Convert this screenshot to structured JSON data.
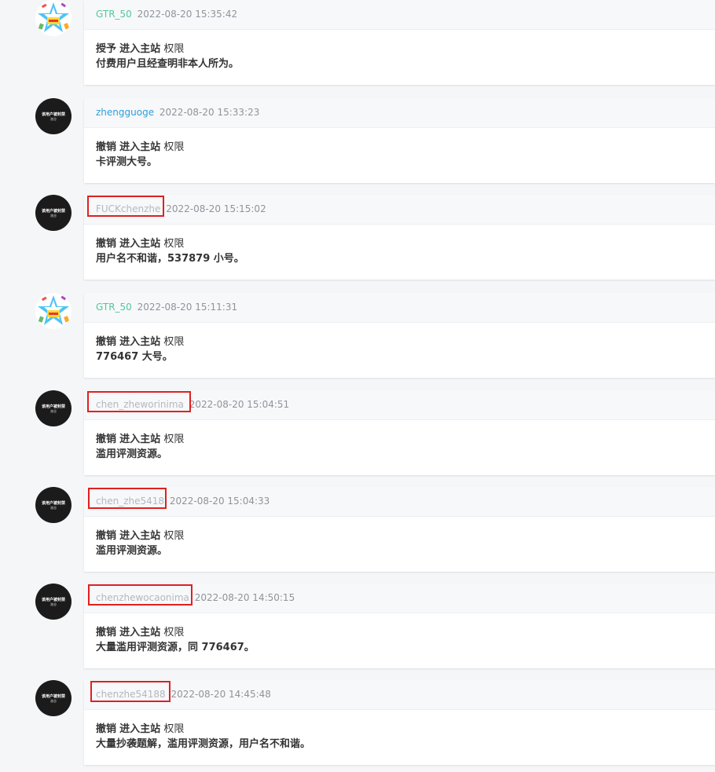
{
  "entries": [
    {
      "avatar": "star-badge",
      "username": "GTR_50",
      "user_color": "green",
      "timestamp": "2022-08-20 15:35:42",
      "action": "授予",
      "target": "进入主站",
      "suffix": "权限",
      "reason": "付费用户且经查明非本人所为。",
      "highlighted": false
    },
    {
      "avatar": "banned",
      "username": "zhengguoge",
      "user_color": "blue",
      "timestamp": "2022-08-20 15:33:23",
      "action": "撤销",
      "target": "进入主站",
      "suffix": "权限",
      "reason": "卡评测大号。",
      "highlighted": false
    },
    {
      "avatar": "banned",
      "username": "FUCKchenzhe",
      "user_color": "grey",
      "timestamp": "2022-08-20 15:15:02",
      "action": "撤销",
      "target": "进入主站",
      "suffix": "权限",
      "reason": "用户名不和谐，537879 小号。",
      "highlighted": true
    },
    {
      "avatar": "star-badge",
      "username": "GTR_50",
      "user_color": "green",
      "timestamp": "2022-08-20 15:11:31",
      "action": "撤销",
      "target": "进入主站",
      "suffix": "权限",
      "reason": "776467 大号。",
      "highlighted": false
    },
    {
      "avatar": "banned",
      "username": "chen_zheworinima",
      "user_color": "grey",
      "timestamp": "2022-08-20 15:04:51",
      "action": "撤销",
      "target": "进入主站",
      "suffix": "权限",
      "reason": "滥用评测资源。",
      "highlighted": true
    },
    {
      "avatar": "banned",
      "username": "chen_zhe5418",
      "user_color": "grey",
      "timestamp": "2022-08-20 15:04:33",
      "action": "撤销",
      "target": "进入主站",
      "suffix": "权限",
      "reason": "滥用评测资源。",
      "highlighted": true
    },
    {
      "avatar": "banned",
      "username": "chenzhewocaonima",
      "user_color": "grey",
      "timestamp": "2022-08-20 14:50:15",
      "action": "撤销",
      "target": "进入主站",
      "suffix": "权限",
      "reason": "大量滥用评测资源，同 776467。",
      "highlighted": true
    },
    {
      "avatar": "banned",
      "username": "chenzhe54188",
      "user_color": "grey",
      "timestamp": "2022-08-20 14:45:48",
      "action": "撤销",
      "target": "进入主站",
      "suffix": "权限",
      "reason": "大量抄袭题解，滥用评测资源，用户名不和谐。",
      "highlighted": true
    }
  ],
  "banned_avatar": {
    "line1": "该用户被封禁",
    "line2": "洛谷"
  },
  "colors": {
    "highlight_border": "#e02020",
    "user_green": "#52c89a",
    "user_blue": "#2f9fd8",
    "user_grey": "#b4b8bd"
  }
}
